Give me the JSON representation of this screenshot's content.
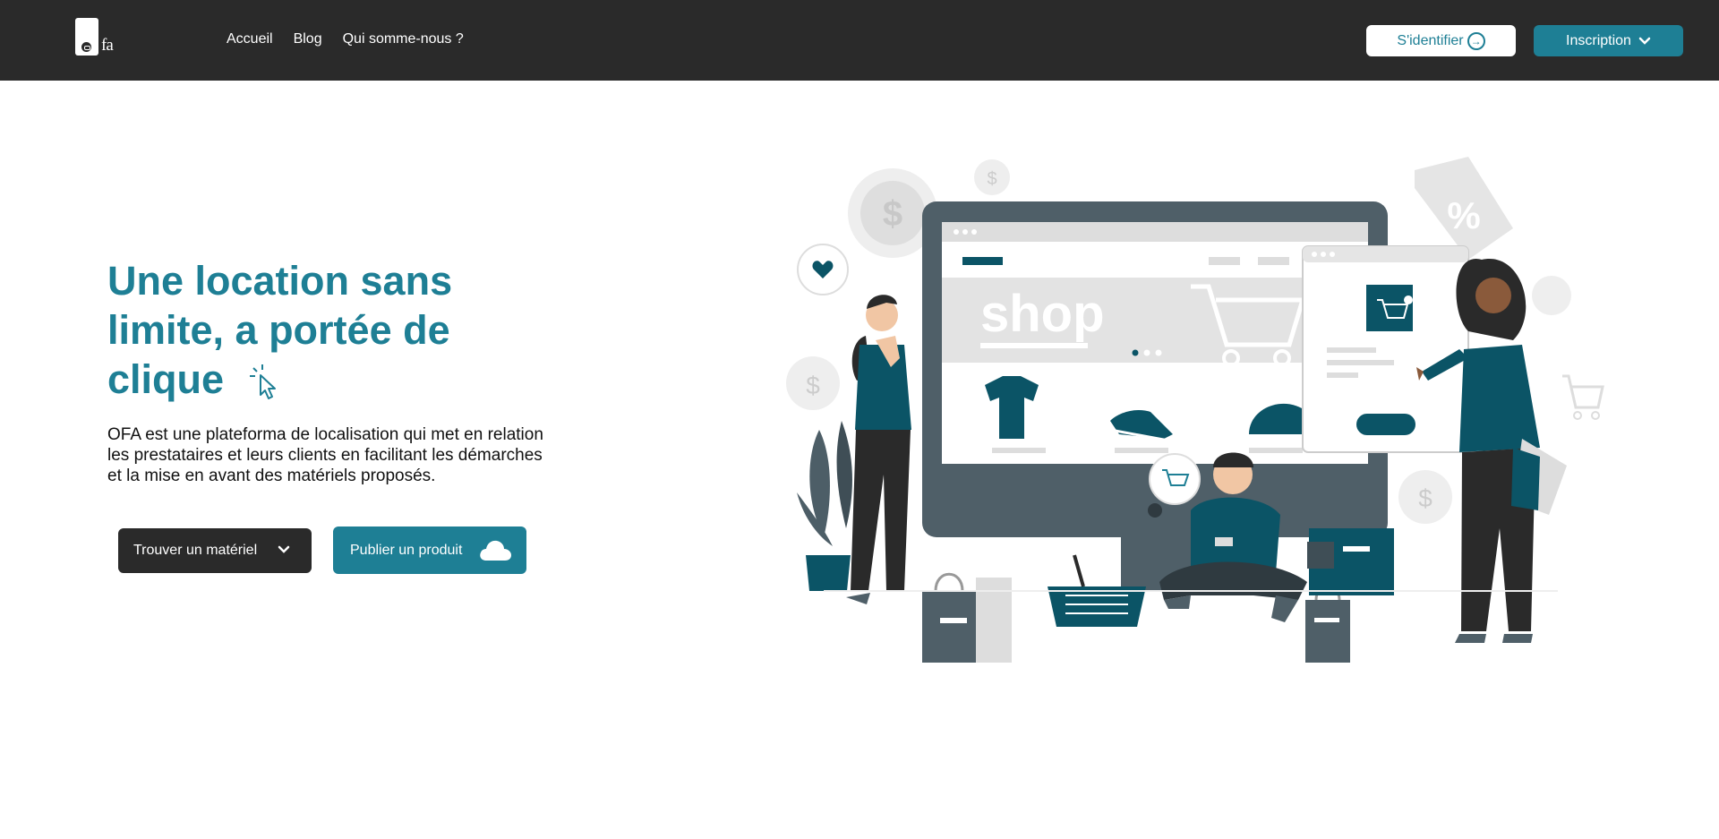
{
  "brand": {
    "logo_text": "fa"
  },
  "nav": {
    "links": [
      {
        "label": "Accueil"
      },
      {
        "label": "Blog"
      },
      {
        "label": "Qui somme-nous ?"
      }
    ],
    "login_label": "S'identifier",
    "signup_label": "Inscription"
  },
  "hero": {
    "title": "Une location sans limite, a portée de clique",
    "description": "OFA est une plateforma de localisation qui met en relation les prestataires et leurs clients en facilitant les démarches et la mise en avant des matériels proposés.",
    "find_button": "Trouver un matériel",
    "publish_button": "Publier un produit"
  },
  "illustration": {
    "shop_text": "shop",
    "price_tag_text": "%",
    "coin_text": "$"
  },
  "colors": {
    "accent": "#1e7f95",
    "dark": "#2a2a2a",
    "teal_dark": "#0b5466"
  },
  "icons": [
    "login-circle-arrow-icon",
    "chevron-down-icon",
    "cursor-click-icon",
    "cloud-icon"
  ]
}
